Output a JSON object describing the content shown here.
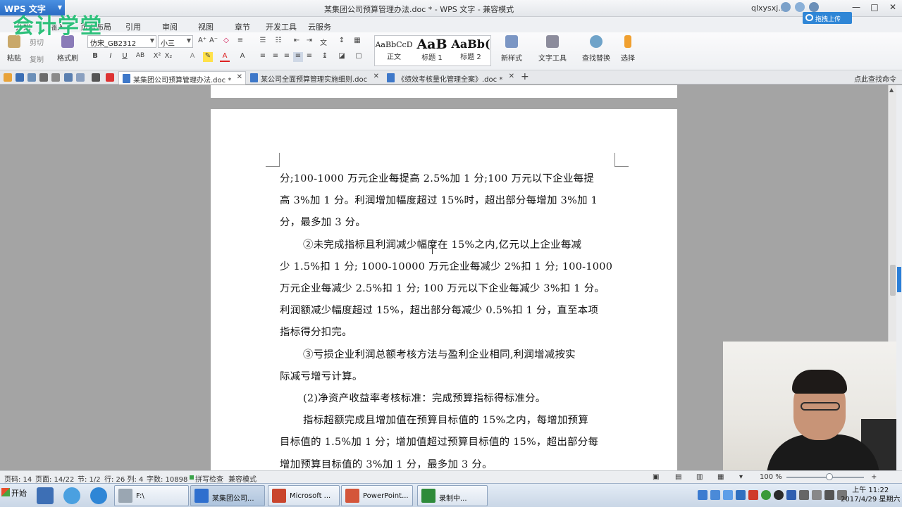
{
  "window": {
    "app_name": "WPS 文字",
    "title": "某集团公司预算管理办法.doc * - WPS 文字 - 兼容模式",
    "user": "qlxysxj...",
    "upload_label": "拖拽上传",
    "controls": [
      "—",
      "□",
      "✕"
    ]
  },
  "watermark": "会计学堂",
  "menu_tabs": [
    "开始",
    "插入",
    "页面布局",
    "引用",
    "审阅",
    "视图",
    "章节",
    "开发工具",
    "云服务"
  ],
  "ribbon": {
    "paste": "粘贴",
    "cut": "剪切",
    "copy": "复制",
    "format_painter": "格式刷",
    "font_name": "仿宋_GB2312",
    "font_size": "小三",
    "styles": [
      {
        "sample": "AaBbCcD",
        "label": "正文"
      },
      {
        "sample": "AaB",
        "label": "标题 1"
      },
      {
        "sample": "AaBb(",
        "label": "标题 2"
      }
    ],
    "new_style": "新样式",
    "text_tools": "文字工具",
    "find_replace": "查找替换",
    "select": "选择"
  },
  "doc_tabs": [
    {
      "label": "某集团公司预算管理办法.doc *",
      "active": true
    },
    {
      "label": "某公司全面预算管理实施细则.doc",
      "active": false
    },
    {
      "label": "《绩效考核量化管理全案》.doc *",
      "active": false
    }
  ],
  "find_command": "点此查找命令",
  "document": {
    "lines": [
      {
        "text": "分;100-1000 万元企业每提高 2.5%加 1 分;100 万元以下企业每提",
        "indent": false
      },
      {
        "text": "高 3%加 1 分。利润增加幅度超过 15%时，超出部分每增加 3%加 1",
        "indent": false
      },
      {
        "text": "分，最多加 3 分。",
        "indent": false
      },
      {
        "text": "②未完成指标且利润减少幅度在 15%之内,亿元以上企业每减",
        "indent": true
      },
      {
        "text": "少 1.5%扣 1 分; 1000-10000 万元企业每减少 2%扣 1 分; 100-1000",
        "indent": false
      },
      {
        "text": "万元企业每减少 2.5%扣 1 分; 100 万元以下企业每减少 3%扣 1 分。",
        "indent": false
      },
      {
        "text": "利润额减少幅度超过 15%，超出部分每减少 0.5%扣 1 分，直至本项",
        "indent": false
      },
      {
        "text": "指标得分扣完。",
        "indent": false
      },
      {
        "text": "③亏损企业利润总额考核方法与盈利企业相同,利润增减按实",
        "indent": true
      },
      {
        "text": "际减亏增亏计算。",
        "indent": false
      },
      {
        "text": "(2)净资产收益率考核标准：完成预算指标得标准分。",
        "indent": true
      },
      {
        "text": "指标超额完成且增加值在预算目标值的 15%之内，每增加预算",
        "indent": true
      },
      {
        "text": "目标值的 1.5%加 1 分；增加值超过预算目标值的 15%，超出部分每",
        "indent": false
      },
      {
        "text": "增加预算目标值的 3%加 1 分，最多加 3 分。",
        "indent": false
      }
    ]
  },
  "status": {
    "page_code": "页码: 14",
    "page": "页面: 14/22",
    "section": "节: 1/2",
    "row_col": "行: 26  列: 4",
    "word_count": "字数: 10898",
    "spell_check": "拼写检查",
    "compat": "兼容模式",
    "zoom": "100 %",
    "zoom_fraction": 0.55
  },
  "taskbar": {
    "start": "开始",
    "tasks": [
      {
        "label": "F:\\",
        "color": "#9aa6b2"
      },
      {
        "label": "某集团公司...",
        "color": "#2f6fce",
        "active": true
      },
      {
        "label": "Microsoft ...",
        "color": "#c9452d"
      },
      {
        "label": "PowerPoint...",
        "color": "#d4553a"
      },
      {
        "label": "录制中...",
        "color": "#2e8b3a"
      }
    ],
    "time": "上午 11:22",
    "date": "2017/4/29 星期六"
  }
}
